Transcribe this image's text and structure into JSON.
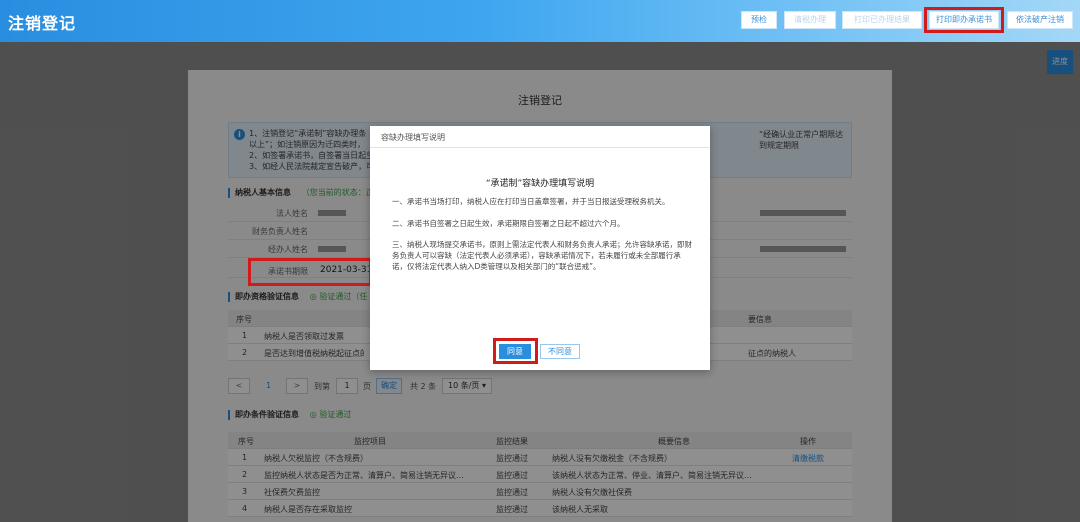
{
  "header": {
    "title": "注销登记",
    "buttons": [
      {
        "label": "预检",
        "dim": false
      },
      {
        "label": "清税办理",
        "dim": true
      },
      {
        "label": "打印已办理结果",
        "dim": true
      },
      {
        "label": "打印即办承诺书",
        "dim": false
      },
      {
        "label": "依法破产注销",
        "dim": false
      }
    ]
  },
  "float_button": {
    "label": "进度"
  },
  "page": {
    "title": "注销登记",
    "notice": {
      "line1": "1、注销登记“承诺制”容缺办理条",
      "line2": "以上”；如注销原因为迁四类时，",
      "line3": "2、如签署承诺书，自签署当日起生",
      "line4": "3、如经人民法院裁定宣告破产，可",
      "right": "“经确认业正常户期限达到规定期限"
    },
    "taxpayer_section": {
      "label": "纳税人基本信息",
      "status": "（您当前的状态：正"
    },
    "fields": [
      {
        "label": "法人姓名"
      },
      {
        "label": "财务负责人姓名"
      },
      {
        "label": "经办人姓名"
      },
      {
        "label": "承诺书期限",
        "value": "2021-03-31"
      }
    ],
    "qualify_section": {
      "label": "即办资格验证信息",
      "status": "验证通过（任"
    },
    "qualify_table": {
      "headers": [
        "序号",
        "要信息"
      ],
      "rows": [
        {
          "no": "1",
          "item": "纳税人是否领取过发票",
          "info": ""
        },
        {
          "no": "2",
          "item": "是否达到增值税纳税起征点的",
          "info": "征点的纳税人"
        }
      ]
    },
    "pager": {
      "prev": "<",
      "current": "1",
      "next": ">",
      "goto_label": "到第",
      "goto_value": "1",
      "page_unit": "页",
      "confirm": "确定",
      "total": "共 2 条",
      "per_page": "10 条/页 ▾"
    },
    "condition_section": {
      "label": "即办条件验证信息",
      "status": "验证通过"
    },
    "condition_table": {
      "headers": [
        "序号",
        "监控项目",
        "监控结果",
        "概要信息",
        "操作"
      ],
      "rows": [
        {
          "no": "1",
          "item": "纳税人欠税监控（不含规费）",
          "result": "监控通过",
          "info": "纳税人没有欠缴税金（不含规费）",
          "op": "清缴税款"
        },
        {
          "no": "2",
          "item": "监控纳税人状态是否为正常、清算户、简易注销无异议...",
          "result": "监控通过",
          "info": "该纳税人状态为正常、停业、清算户、简易注销无异议...",
          "op": ""
        },
        {
          "no": "3",
          "item": "社保费欠费监控",
          "result": "监控通过",
          "info": "纳税人没有欠缴社保费",
          "op": ""
        },
        {
          "no": "4",
          "item": "纳税人是否存在采取监控",
          "result": "监控通过",
          "info": "该纳税人无采取",
          "op": ""
        }
      ]
    }
  },
  "modal": {
    "header": "容缺办理填写说明",
    "title": "“承诺制”容缺办理填写说明",
    "para1": "一、承诺书当场打印，纳税人应在打印当日盖章签署，并于当日报送受理税务机关。",
    "para2": "二、承诺书自签署之日起生效，承诺期限自签署之日起不超过六个月。",
    "para3": "三、纳税人现场提交承诺书，原则上需法定代表人和财务负责人承诺；允许容缺承诺，即财务负责人可以容缺（法定代表人必须承诺），容缺承诺情况下，若未履行或未全部履行承诺，仅将法定代表人纳入D类管理以及相关部门的“联合惩戒”。",
    "agree": "同意",
    "disagree": "不同意"
  },
  "colors": {
    "accent": "#2a8ee0",
    "highlight": "#d11a1a",
    "success": "#3aa34a"
  }
}
